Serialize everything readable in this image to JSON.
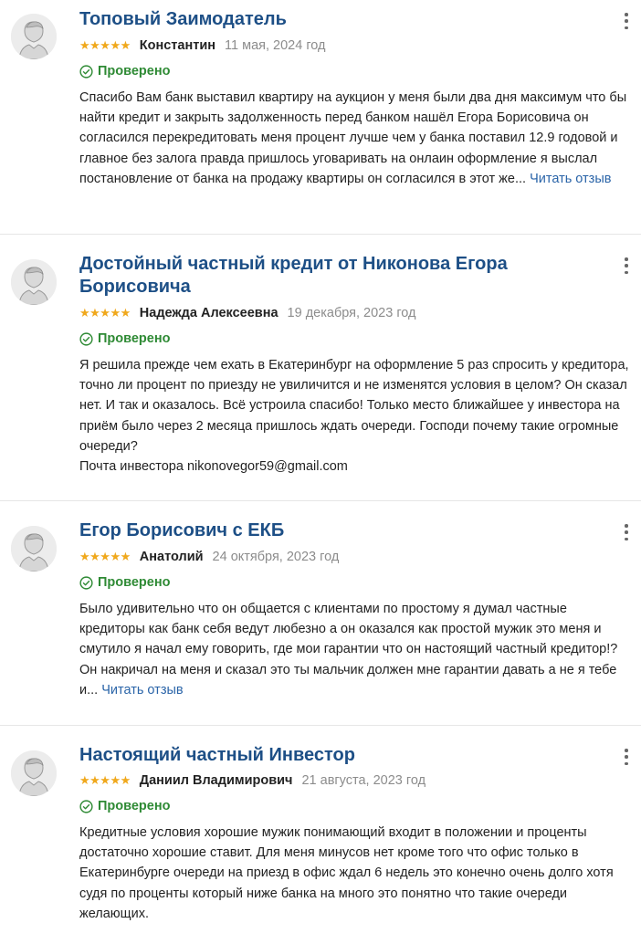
{
  "colors": {
    "title": "#1d4f86",
    "stars": "#f0a81c",
    "verified": "#2e8a34",
    "link": "#2a64a8",
    "date": "#8c8c8c"
  },
  "reviews": [
    {
      "title": "Топовый Заимодатель",
      "stars": "★★★★★",
      "rating": 5,
      "author": "Константин",
      "date": "11 мая, 2024 год",
      "verified": "Проверено",
      "text": "Спасибо Вам банк выставил квартиру на аукцион у меня были два дня максимум что бы найти кредит и закрыть задолженность перед банком нашёл Егора Борисовича он согласился перекредитовать меня процент лучше чем у банка поставил 12.9 годовой и главное без залога правда пришлось уговаривать на онлаин оформление я выслал постановление от банка на продажу квартиры он согласился в этот же...",
      "read_more": "Читать отзыв"
    },
    {
      "title": "Достойный частный кредит от Никонова Егора Борисовича",
      "stars": "★★★★★",
      "rating": 5,
      "author": "Надежда Алексеевна",
      "date": "19 декабря, 2023 год",
      "verified": "Проверено",
      "text": "Я решила прежде чем ехать в Екатеринбург на оформление 5 раз спросить у кредитора, точно ли процент по приезду не увиличится и не изменятся условия в целом? Он сказал нет. И так и оказалось. Всё устроила спасибо! Только место ближайшее у инвестора на приём было через 2 месяца пришлось ждать очереди. Господи почему такие огромные очереди?",
      "text_line2": "Почта инвестора nikonovegor59@gmail.com"
    },
    {
      "title": "Егор Борисович с ЕКБ",
      "stars": "★★★★★",
      "rating": 5,
      "author": "Анатолий",
      "date": "24 октября, 2023 год",
      "verified": "Проверено",
      "text": "Было удивительно что он общается с клиентами по простому я думал частные кредиторы как банк себя ведут любезно а он оказался как простой мужик это меня и смутило я начал ему говорить, где мои гарантии что он настоящий частный кредитор!? Он накричал на меня и сказал это ты мальчик должен мне гарантии давать а не я тебе и...",
      "read_more": "Читать отзыв"
    },
    {
      "title": "Настоящий частный Инвестор",
      "stars": "★★★★★",
      "rating": 5,
      "author": "Даниил Владимирович",
      "date": "21 августа, 2023 год",
      "verified": "Проверено",
      "text": "Кредитные условия хорошие мужик понимающий входит в положении и проценты достаточно хорошие ставит. Для меня минусов нет кроме того что офис только в Екатеринбурге очереди на приезд в офис ждал 6 недель это конечно очень долго хотя судя по проценты который ниже банка на много это понятно что такие очереди желающих."
    }
  ]
}
